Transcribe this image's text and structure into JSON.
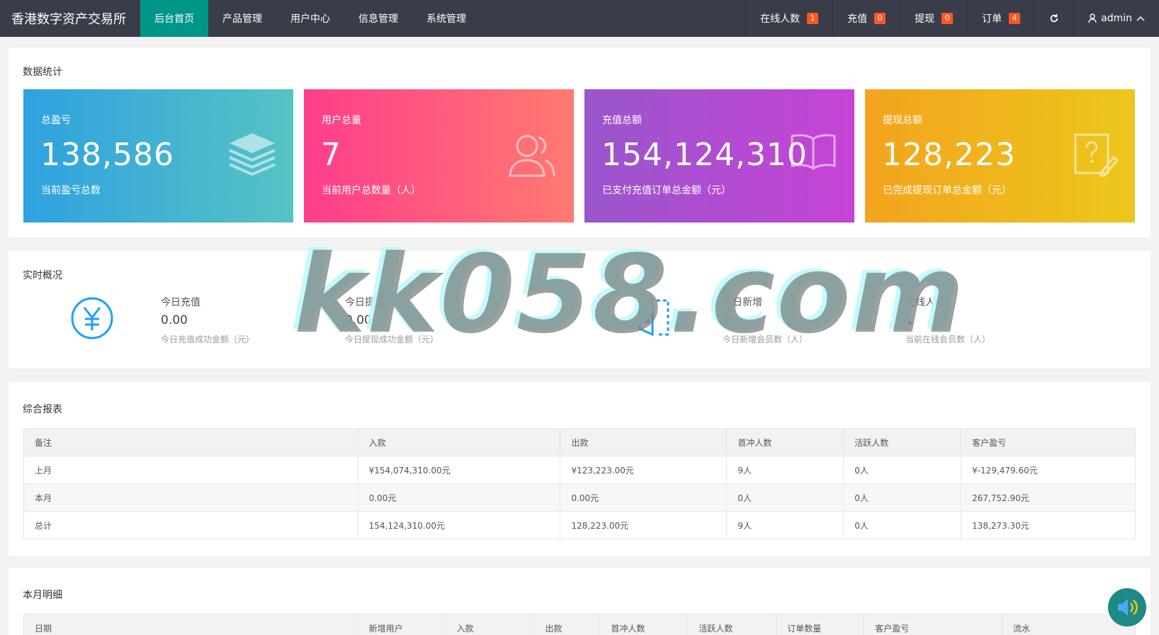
{
  "header": {
    "brand": "香港数字资产交易所",
    "nav": [
      "后台首页",
      "产品管理",
      "用户中心",
      "信息管理",
      "系统管理"
    ],
    "right": [
      {
        "label": "在线人数",
        "badge": "1"
      },
      {
        "label": "充值",
        "badge": "0"
      },
      {
        "label": "提现",
        "badge": "0"
      },
      {
        "label": "订单",
        "badge": "4"
      }
    ],
    "user": "admin",
    "icons": [
      "refresh-icon",
      "user-icon",
      "chevron-up-icon"
    ]
  },
  "stats": {
    "title": "数据统计",
    "cards": [
      {
        "label": "总盈亏",
        "value": "138,586",
        "sub": "当前盈亏总数",
        "icon": "layers-icon"
      },
      {
        "label": "用户总量",
        "value": "7",
        "sub": "当前用户总数量（人）",
        "icon": "users-icon"
      },
      {
        "label": "充值总额",
        "value": "154,124,310",
        "sub": "已支付充值订单总金额（元）",
        "icon": "book-icon"
      },
      {
        "label": "提现总额",
        "value": "128,223",
        "sub": "已完成提现订单总金额（元）",
        "icon": "question-edit-icon"
      }
    ],
    "colors": [
      "#2fa1e0",
      "#ff3d8b",
      "#9956cc",
      "#f3a41e"
    ]
  },
  "realtime": {
    "title": "实时概况",
    "items": [
      {
        "title": "今日充值",
        "value": "0.00",
        "desc": "今日充值成功金额（元）",
        "icon": "yuan-icon"
      },
      {
        "title": "今日提现",
        "value": "0.00",
        "desc": "今日提现成功金额（元）"
      },
      {
        "title": "今日新增",
        "value": "0",
        "desc": "今日新增会员数（人）",
        "icon": "exit-icon"
      },
      {
        "title": "在线人数",
        "value": "1",
        "desc": "当前在线会员数（人）"
      }
    ]
  },
  "report": {
    "title": "综合报表",
    "headers": [
      "备注",
      "入款",
      "出款",
      "首冲人数",
      "活跃人数",
      "客户盈亏"
    ],
    "rows": [
      [
        "上月",
        "¥154,074,310.00元",
        "¥123,223.00元",
        "9人",
        "0人",
        "¥-129,479.60元"
      ],
      [
        "本月",
        "0.00元",
        "0.00元",
        "0人",
        "0人",
        "267,752.90元"
      ],
      [
        "总计",
        "154,124,310.00元",
        "128,223.00元",
        "9人",
        "0人",
        "138,273.30元"
      ]
    ]
  },
  "monthly": {
    "title": "本月明细",
    "headers": [
      "日期",
      "新增用户",
      "入款",
      "出款",
      "首冲人数",
      "活跃人数",
      "订单数量",
      "客户盈亏",
      "流水"
    ]
  },
  "watermark": "kk058.com"
}
